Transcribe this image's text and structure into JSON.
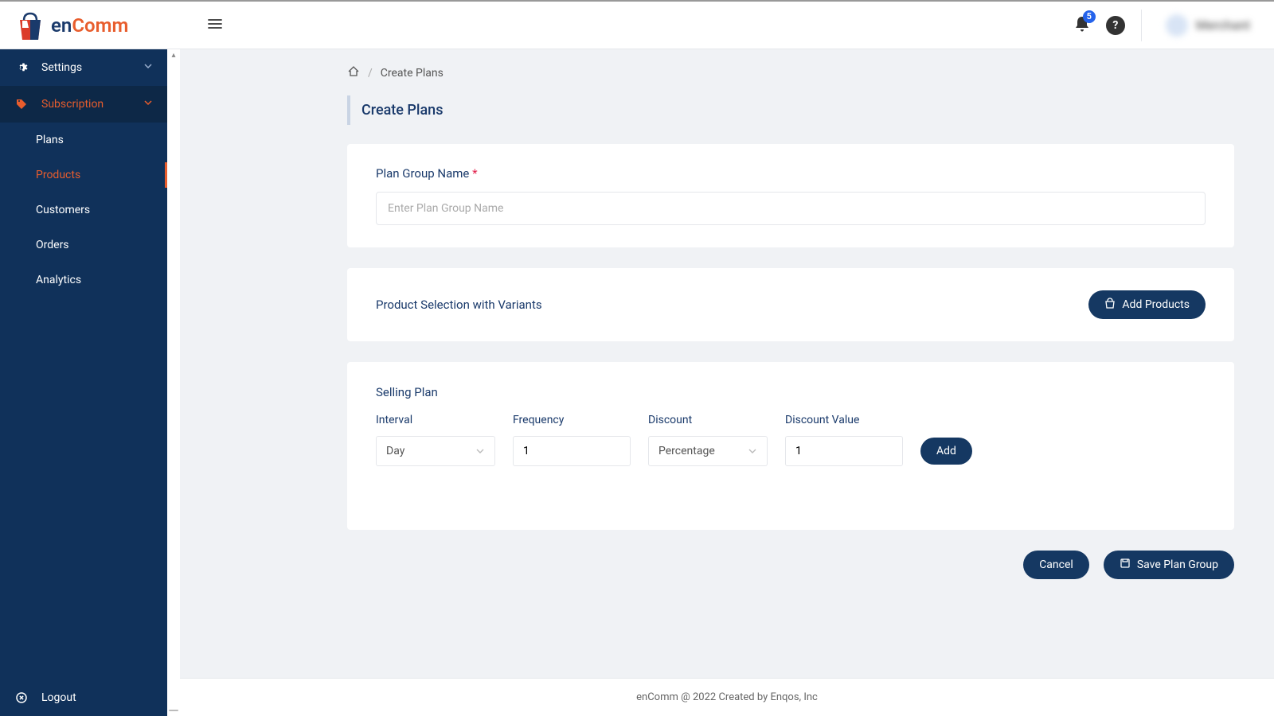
{
  "brand": {
    "prefix": "en",
    "suffix": "Comm"
  },
  "header": {
    "notification_count": "5",
    "username": "Merchant"
  },
  "sidebar": {
    "settings": "Settings",
    "subscription": "Subscription",
    "sub_items": [
      "Plans",
      "Products",
      "Customers",
      "Orders",
      "Analytics"
    ],
    "logout": "Logout"
  },
  "breadcrumb": {
    "current": "Create Plans"
  },
  "page": {
    "title": "Create Plans"
  },
  "plan_group": {
    "label": "Plan Group Name",
    "placeholder": "Enter Plan Group Name"
  },
  "product_section": {
    "title": "Product Selection with Variants",
    "add_btn": "Add Products"
  },
  "selling_plan": {
    "title": "Selling Plan",
    "interval_label": "Interval",
    "interval_value": "Day",
    "frequency_label": "Frequency",
    "frequency_value": "1",
    "discount_label": "Discount",
    "discount_value": "Percentage",
    "discount_value_label": "Discount Value",
    "discount_value_value": "1",
    "add_btn": "Add"
  },
  "actions": {
    "cancel": "Cancel",
    "save": "Save Plan Group"
  },
  "footer": {
    "text": "enComm @ 2022 Created by Enqos, Inc"
  }
}
